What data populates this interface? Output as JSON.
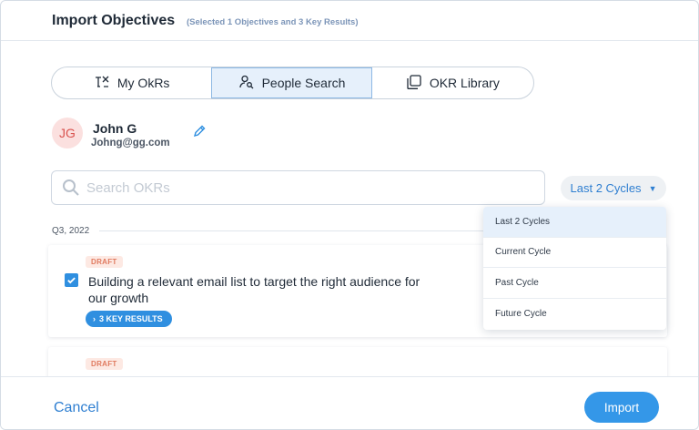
{
  "header": {
    "title": "Import Objectives",
    "subtitle": "(Selected 1 Objectives and 3 Key Results)"
  },
  "tabs": [
    {
      "label": "My OkRs",
      "icon": "my-okrs-icon",
      "active": false
    },
    {
      "label": "People Search",
      "icon": "person-search-icon",
      "active": true
    },
    {
      "label": "OKR Library",
      "icon": "library-icon",
      "active": false
    }
  ],
  "user": {
    "initials": "JG",
    "name": "John G",
    "email": "Johng@gg.com"
  },
  "search": {
    "placeholder": "Search OKRs",
    "value": ""
  },
  "cycle_filter": {
    "selected": "Last 2 Cycles",
    "options": [
      "Last 2 Cycles",
      "Current Cycle",
      "Past Cycle",
      "Future Cycle"
    ]
  },
  "section": {
    "label": "Q3, 2022"
  },
  "objectives": [
    {
      "status": "DRAFT",
      "checked": true,
      "title": "Building a relevant email list to target the right audience for our growth",
      "key_results_label": "3 KEY RESULTS"
    },
    {
      "status": "DRAFT"
    }
  ],
  "footer": {
    "cancel_label": "Cancel",
    "import_label": "Import"
  },
  "colors": {
    "accent": "#2f8fe0",
    "draft_badge": "#e07a5f",
    "avatar_bg": "#fbe0df"
  }
}
